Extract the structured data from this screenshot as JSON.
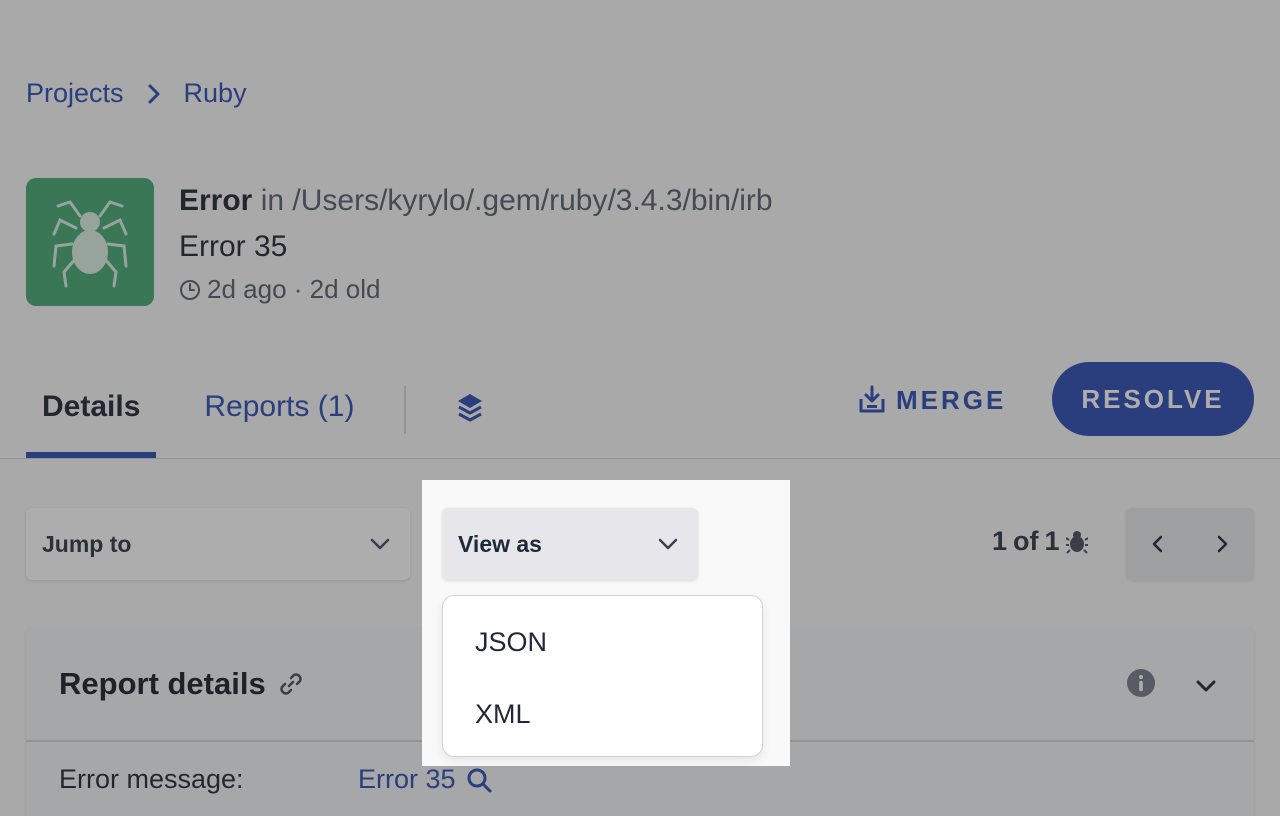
{
  "breadcrumb": {
    "items": [
      "Projects",
      "Ruby"
    ]
  },
  "error": {
    "type": "Error",
    "location": "in /Users/kyrylo/.gem/ruby/3.4.3/bin/irb",
    "title": "Error 35",
    "meta": "2d ago · 2d old",
    "avatar_color": "#37a36a"
  },
  "tabs": {
    "details": "Details",
    "reports": "Reports (1)"
  },
  "actions": {
    "merge": "MERGE",
    "resolve": "RESOLVE",
    "accent": "#1e40af"
  },
  "controls": {
    "jump_to": "Jump to",
    "view_as": "View as",
    "counter_current": "1",
    "counter_of": "of",
    "counter_total": "1"
  },
  "view_as_menu": {
    "options": [
      "JSON",
      "XML"
    ]
  },
  "card": {
    "title": "Report details",
    "rows": [
      {
        "label": "Error message:",
        "value": "Error 35"
      }
    ]
  }
}
